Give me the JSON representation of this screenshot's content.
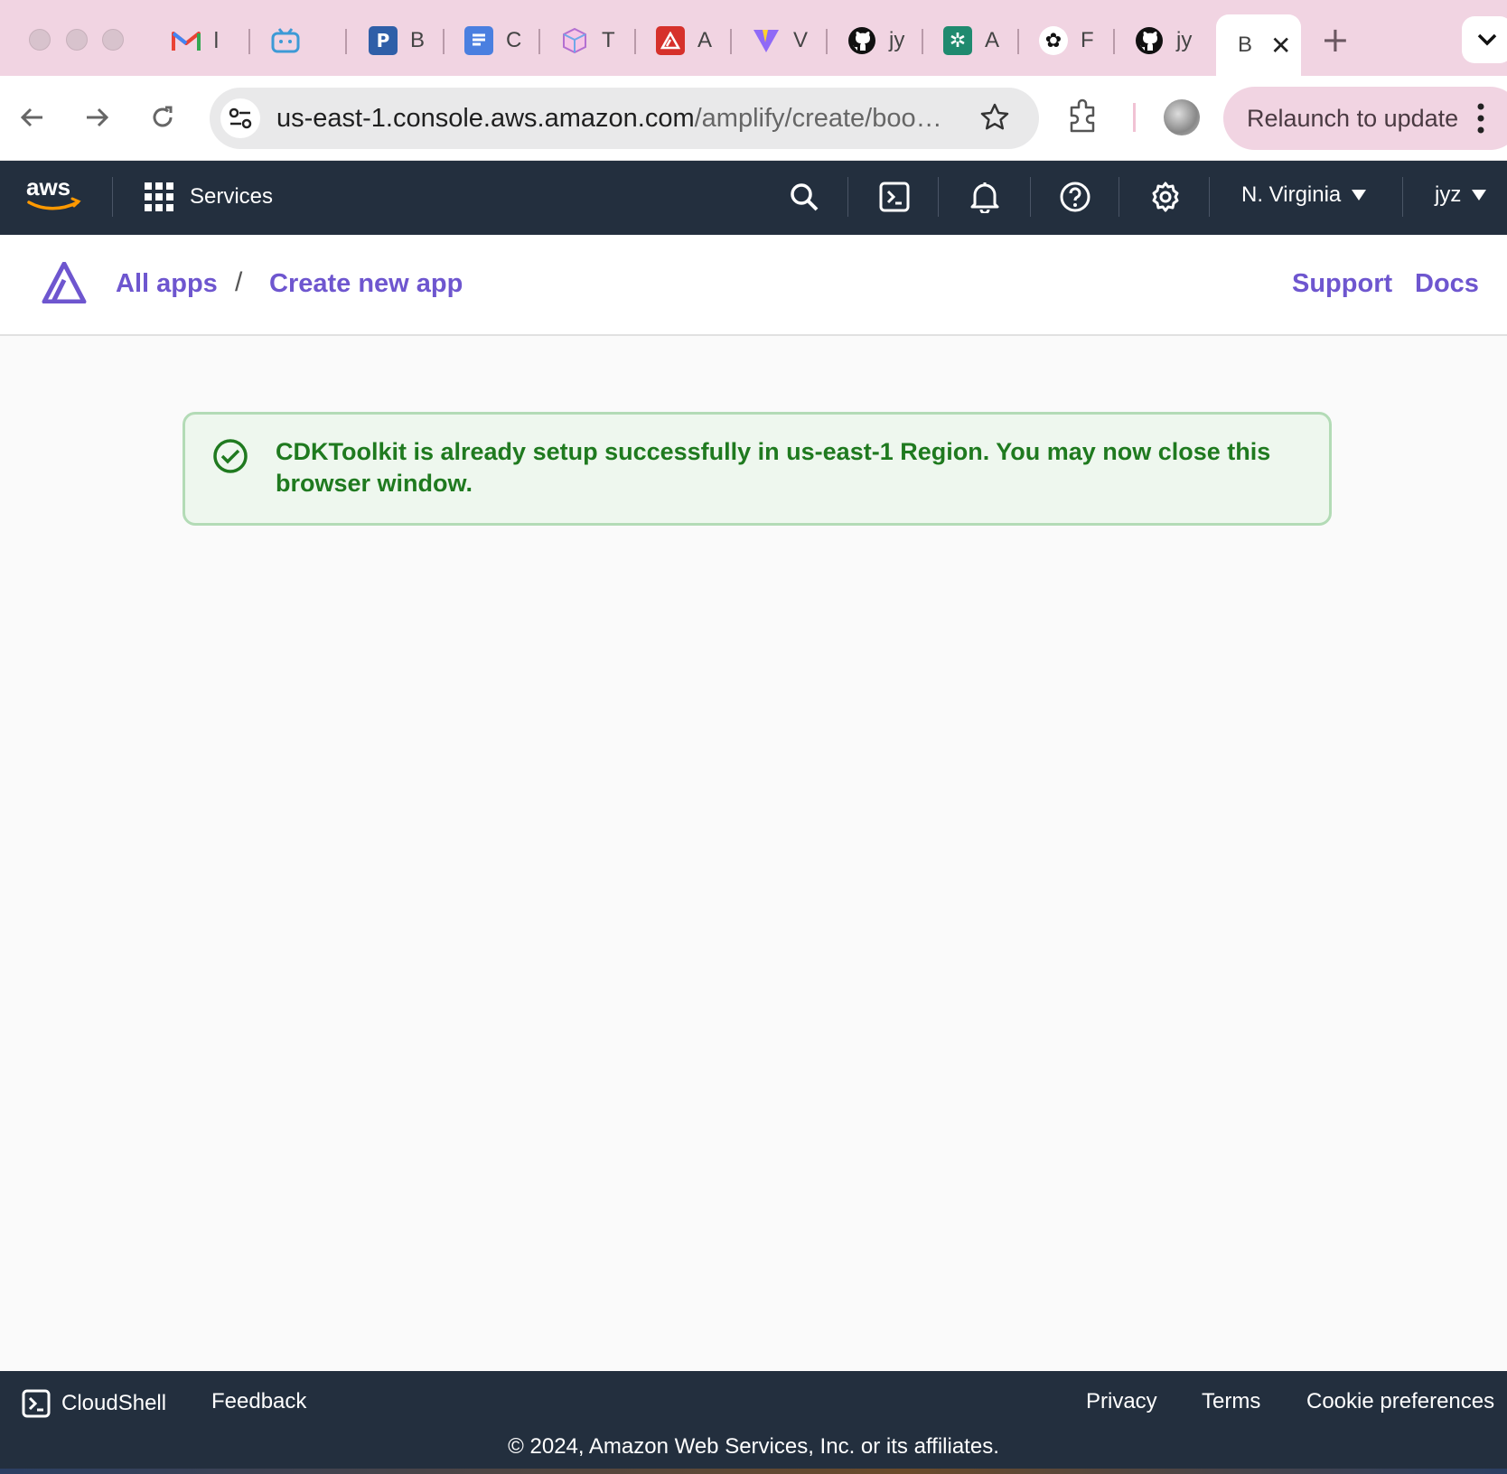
{
  "browser": {
    "tabs": [
      {
        "icon": "gmail-icon",
        "title": "ⅼ"
      },
      {
        "icon": "bilibili-icon",
        "title": ""
      },
      {
        "icon": "p-app-icon",
        "title": "B"
      },
      {
        "icon": "google-docs-icon",
        "title": "C"
      },
      {
        "icon": "cube-icon",
        "title": "T"
      },
      {
        "icon": "amplify-red-icon",
        "title": "A"
      },
      {
        "icon": "vite-icon",
        "title": "V"
      },
      {
        "icon": "github-icon",
        "title": "jy"
      },
      {
        "icon": "chatgpt-green-icon",
        "title": "A"
      },
      {
        "icon": "openai-icon",
        "title": "F"
      },
      {
        "icon": "github-icon",
        "title": "jy"
      }
    ],
    "active_tab": {
      "title": "B",
      "close": "✕"
    },
    "new_tab": "+",
    "url_host": "us-east-1.console.aws.amazon.com",
    "url_path": "/amplify/create/boo…",
    "relaunch_label": "Relaunch to update"
  },
  "aws_nav": {
    "services_label": "Services",
    "region_label": "N. Virginia",
    "user_label": "jyz"
  },
  "amplify": {
    "crumb_all_apps": "All apps",
    "crumb_separator": "/",
    "crumb_create": "Create new app",
    "support_label": "Support",
    "docs_label": "Docs"
  },
  "alert": {
    "message": "CDKToolkit is already setup successfully in us-east-1 Region. You may now close this browser window."
  },
  "footer": {
    "cloudshell_label": "CloudShell",
    "feedback_label": "Feedback",
    "privacy_label": "Privacy",
    "terms_label": "Terms",
    "cookie_label": "Cookie preferences",
    "copyright": "© 2024, Amazon Web Services, Inc. or its affiliates."
  },
  "colors": {
    "tabstrip": "#f1d4e2",
    "aws_nav": "#232f3e",
    "amplify_purple": "#6e56cf",
    "success_green": "#1f7a1f"
  }
}
